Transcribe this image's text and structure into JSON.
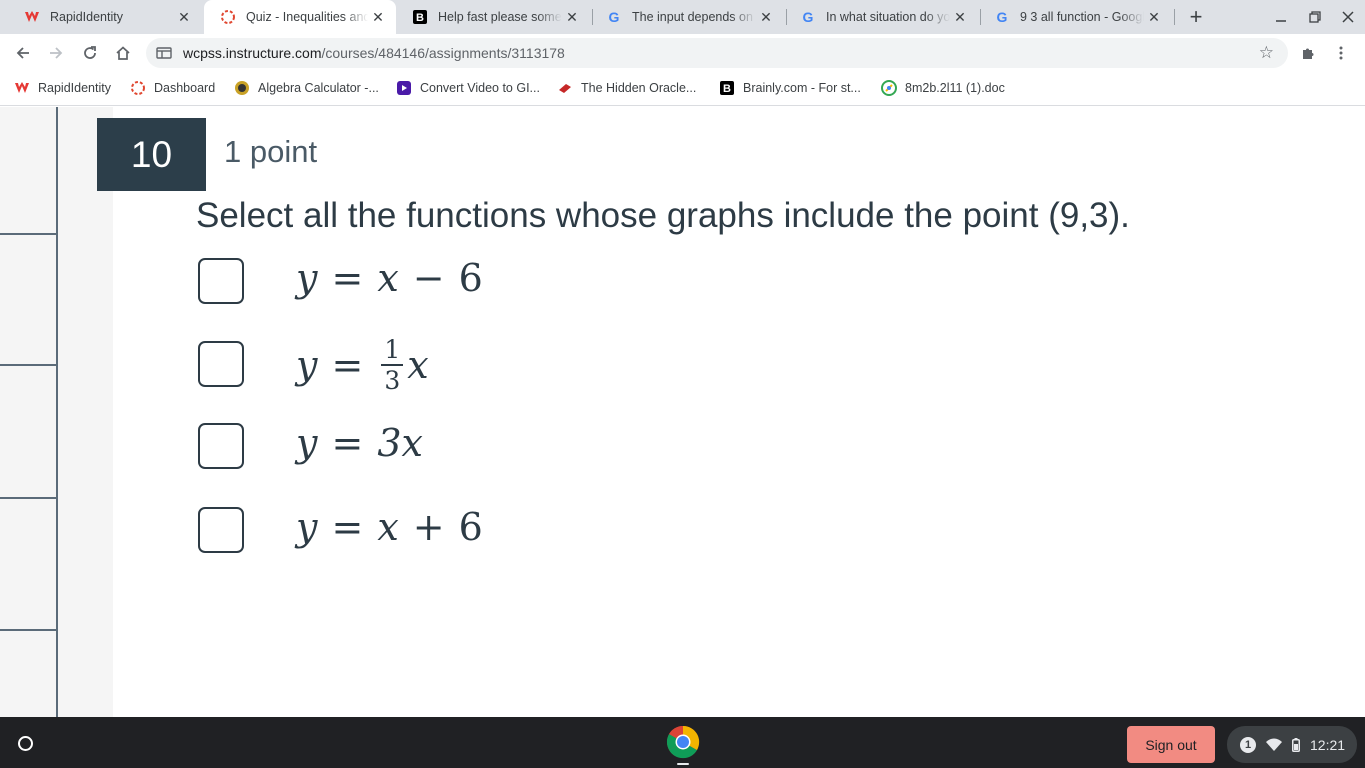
{
  "browser": {
    "tabs": [
      {
        "title": "RapidIdentity",
        "icon": "rapididentity-icon",
        "active": false
      },
      {
        "title": "Quiz - Inequalities and",
        "icon": "canvas-icon",
        "active": true
      },
      {
        "title": "Help fast please some",
        "icon": "brainly-icon",
        "active": false
      },
      {
        "title": "The input depends on t",
        "icon": "google-icon",
        "active": false
      },
      {
        "title": "In what situation do yo",
        "icon": "google-icon",
        "active": false
      },
      {
        "title": "9 3 all function - Googl",
        "icon": "google-icon",
        "active": false
      }
    ],
    "url_domain": "wcpss.instructure.com",
    "url_path": "/courses/484146/assignments/3113178",
    "bookmarks": [
      {
        "label": "RapidIdentity",
        "icon": "rapididentity-icon"
      },
      {
        "label": "Dashboard",
        "icon": "canvas-icon"
      },
      {
        "label": "Algebra Calculator -...",
        "icon": "calculator-icon"
      },
      {
        "label": "Convert Video to GI...",
        "icon": "video-convert-icon"
      },
      {
        "label": "The Hidden Oracle...",
        "icon": "book-icon"
      },
      {
        "label": "Brainly.com - For st...",
        "icon": "brainly-icon"
      },
      {
        "label": "8m2b.2l11 (1).doc",
        "icon": "doc-icon"
      }
    ]
  },
  "quiz": {
    "question_number": "10",
    "points": "1 point",
    "prompt": "Select all the functions whose graphs include the point (9,3).",
    "options": [
      {
        "lhs": "y",
        "eq": "=",
        "parts": [
          "x",
          "−",
          "6"
        ],
        "checked": false
      },
      {
        "lhs": "y",
        "eq": "=",
        "frac_num": "1",
        "frac_den": "3",
        "rhs": "x",
        "checked": false
      },
      {
        "lhs": "y",
        "eq": "=",
        "rhs": "3x",
        "checked": false
      },
      {
        "lhs": "y",
        "eq": "=",
        "parts": [
          "x",
          "+",
          "6"
        ],
        "checked": false
      }
    ]
  },
  "shelf": {
    "signout_label": "Sign out",
    "notification_count": "1",
    "time": "12:21"
  },
  "colors": {
    "question_badge": "#2c3e4a",
    "signout_bg": "#f28b82",
    "text": "#2d3b45"
  }
}
